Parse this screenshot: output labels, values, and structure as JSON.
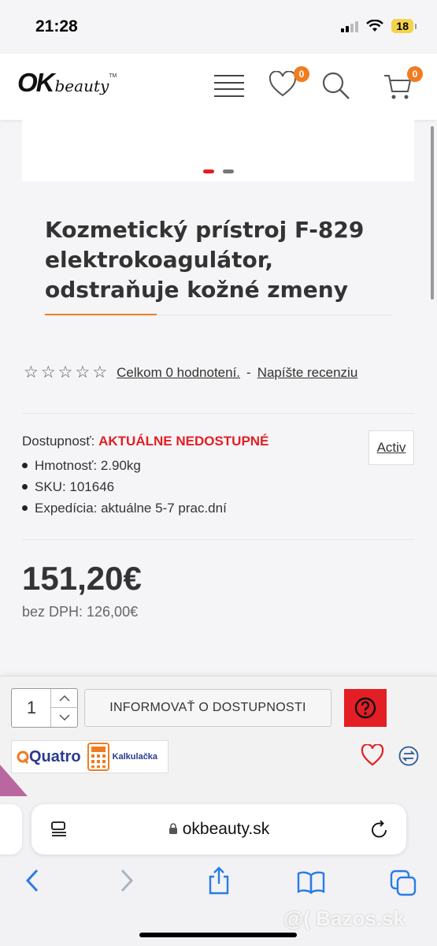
{
  "status_bar": {
    "time": "21:28",
    "battery": "18"
  },
  "header": {
    "logo_ok": "OK",
    "logo_beauty": "beauty",
    "logo_tm": "TM",
    "wishlist_count": "0",
    "cart_count": "0"
  },
  "product": {
    "title": "Kozmetický prístroj F-829 elektrokoagulátor, odstraňuje kožné zmeny",
    "rating_link": "Celkom 0 hodnotení.",
    "rating_separator": "-",
    "review_link": "Napíšte recenziu",
    "availability_label": "Dostupnosť:",
    "availability_status": "AKTUÁLNE NEDOSTUPNÉ",
    "specs": [
      "Hmotnosť: 2.90kg",
      "SKU: 101646",
      "Expedícia: aktuálne 5-7 prac.dní"
    ],
    "activ_label": "Activ",
    "price": "151,20€",
    "price_without_vat": "bez DPH: 126,00€"
  },
  "purchase": {
    "quantity": "1",
    "notify_label": "INFORMOVAŤ O DOSTUPNOSTI",
    "quatro_label": "Quatro",
    "calculator_label": "Kalkulačka"
  },
  "browser": {
    "url": "okbeauty.sk"
  },
  "watermark": "@( Bazos.sk",
  "colors": {
    "accent": "#f07c22",
    "alert": "#e31e24",
    "quatro": "#2b3a8f"
  }
}
